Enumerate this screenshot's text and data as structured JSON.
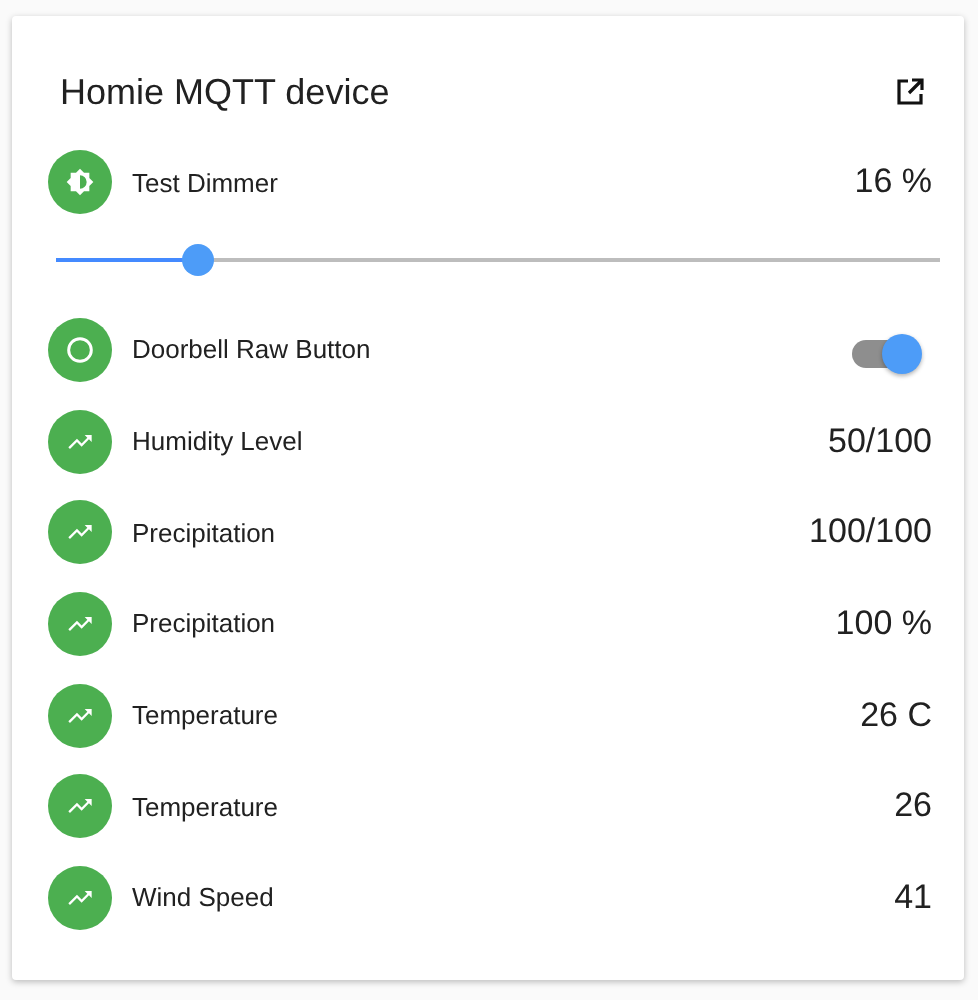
{
  "card": {
    "title": "Homie MQTT device",
    "entities": [
      {
        "kind": "dimmer",
        "name": "Test Dimmer",
        "value": "16 %",
        "level": 0.16
      },
      {
        "kind": "switch",
        "name": "Doorbell Raw Button",
        "on": true
      },
      {
        "kind": "sensor",
        "name": "Humidity Level",
        "value": "50/100"
      },
      {
        "kind": "sensor",
        "name": "Precipitation",
        "value": "100/100"
      },
      {
        "kind": "sensor",
        "name": "Precipitation",
        "value": "100 %"
      },
      {
        "kind": "sensor",
        "name": "Temperature",
        "value": "26 C"
      },
      {
        "kind": "sensor",
        "name": "Temperature",
        "value": "26"
      },
      {
        "kind": "sensor",
        "name": "Wind Speed",
        "value": "41"
      }
    ]
  }
}
